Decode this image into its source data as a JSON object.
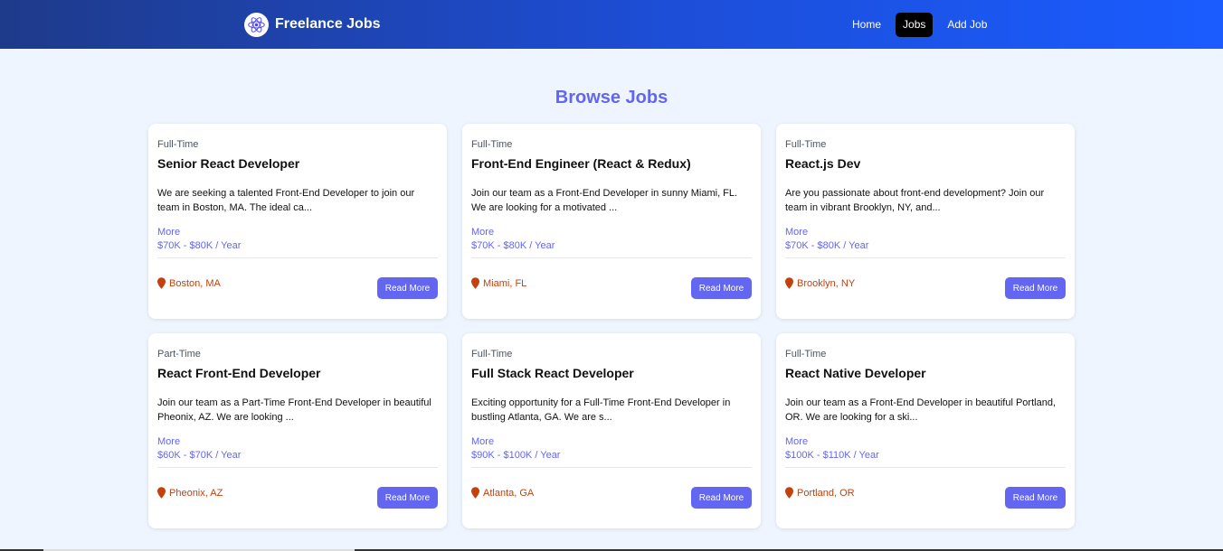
{
  "nav": {
    "brand": "Freelance Jobs",
    "links": [
      {
        "label": "Home"
      },
      {
        "label": "Jobs"
      },
      {
        "label": "Add Job"
      }
    ]
  },
  "page": {
    "title": "Browse Jobs"
  },
  "jobs": [
    {
      "type": "Full-Time",
      "title": "Senior React Developer",
      "description": "We are seeking a talented Front-End Developer to join our team in Boston, MA. The ideal ca...",
      "more": "More",
      "salary": "$70K - $80K / Year",
      "location": "Boston, MA",
      "button": "Read More"
    },
    {
      "type": "Full-Time",
      "title": "Front-End Engineer (React & Redux)",
      "description": "Join our team as a Front-End Developer in sunny Miami, FL. We are looking for a motivated ...",
      "more": "More",
      "salary": "$70K - $80K / Year",
      "location": "Miami, FL",
      "button": "Read More"
    },
    {
      "type": "Full-Time",
      "title": "React.js Dev",
      "description": "Are you passionate about front-end development? Join our team in vibrant Brooklyn, NY, and...",
      "more": "More",
      "salary": "$70K - $80K / Year",
      "location": "Brooklyn, NY",
      "button": "Read More"
    },
    {
      "type": "Part-Time",
      "title": "React Front-End Developer",
      "description": "Join our team as a Part-Time Front-End Developer in beautiful Pheonix, AZ. We are looking ...",
      "more": "More",
      "salary": "$60K - $70K / Year",
      "location": "Pheonix, AZ",
      "button": "Read More"
    },
    {
      "type": "Full-Time",
      "title": "Full Stack React Developer",
      "description": "Exciting opportunity for a Full-Time Front-End Developer in bustling Atlanta, GA. We are s...",
      "more": "More",
      "salary": "$90K - $100K / Year",
      "location": "Atlanta, GA",
      "button": "Read More"
    },
    {
      "type": "Full-Time",
      "title": "React Native Developer",
      "description": "Join our team as a Front-End Developer in beautiful Portland, OR. We are looking for a ski...",
      "more": "More",
      "salary": "$100K - $110K / Year",
      "location": "Portland, OR",
      "button": "Read More"
    }
  ],
  "icons": {
    "logo": "react-logo-icon",
    "location": "map-pin-icon"
  },
  "colors": {
    "accent": "#6366f1",
    "location": "#c2410c",
    "nav_start": "#1e3a8a",
    "nav_end": "#1a5cff"
  }
}
